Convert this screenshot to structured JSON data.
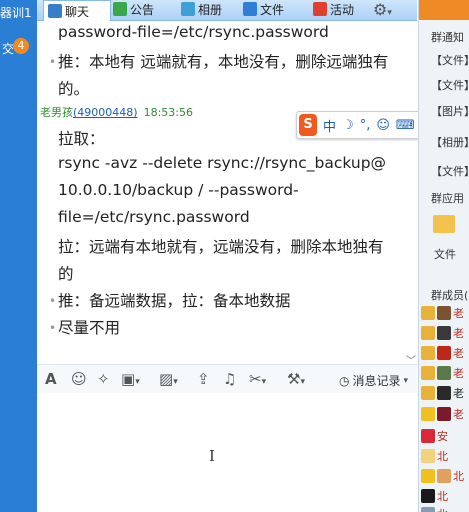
{
  "left": {
    "fragment": "器训1",
    "badge": "4",
    "fragment2": "交"
  },
  "tabs": [
    {
      "label": "聊天",
      "active": true
    },
    {
      "label": "公告"
    },
    {
      "label": "相册"
    },
    {
      "label": "文件"
    },
    {
      "label": "活动"
    }
  ],
  "messages": {
    "line1": "password-file=/etc/rsync.password",
    "line2": "推：本地有 远端就有，本地没有，删除远端独有",
    "line3": "的。",
    "sender_name": "老男孩",
    "sender_qq": "(49000448)",
    "sender_time": "18:53:56",
    "line4": "拉取：",
    "line5": "rsync -avz --delete  rsync://rsync_backup@",
    "line6": "10.0.0.10/backup / --password-",
    "line7": "file=/etc/rsync.password",
    "line8": "拉：远端有本地就有，远端没有，删除本地独有",
    "line9": "的",
    "line10": "推：备远端数据，拉：备本地数据",
    "line11": "尽量不用"
  },
  "ime": {
    "logo": "S",
    "mode": "中"
  },
  "toolbar": {
    "history_label": "消息记录"
  },
  "right": {
    "notice": "群通知",
    "items": [
      "【文件】",
      "【文件】",
      "【图片】",
      "【相册】",
      "【文件】"
    ],
    "apps": "群应用",
    "file_app": "文件",
    "members": "群成员(",
    "member_names": [
      "老",
      "老",
      "老",
      "老",
      "老",
      "老",
      "安",
      "北",
      "北",
      "北",
      "北"
    ]
  },
  "colors": {
    "accent": "#2a7fd4",
    "orange": "#f08a24",
    "member_red": "#c0271b"
  }
}
